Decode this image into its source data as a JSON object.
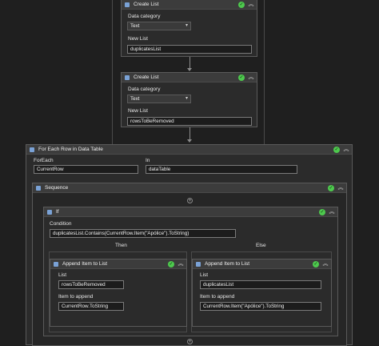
{
  "create_list_1": {
    "title": "Create List",
    "data_category_label": "Data category",
    "data_category_value": "Text",
    "new_list_label": "New List",
    "new_list_value": "duplicatesList"
  },
  "create_list_2": {
    "title": "Create List",
    "data_category_label": "Data category",
    "data_category_value": "Text",
    "new_list_label": "New List",
    "new_list_value": "rowsToBeRemoved"
  },
  "for_each": {
    "title": "For Each Row in Data Table",
    "foreach_label": "ForEach",
    "foreach_value": "CurrentRow",
    "in_label": "In",
    "in_value": "dataTable"
  },
  "sequence": {
    "title": "Sequence"
  },
  "if_block": {
    "title": "If",
    "condition_label": "Condition",
    "condition_value": "duplicatesList.Contains(CurrentRow.Item(\"Apólice\").ToString)",
    "then_label": "Then",
    "else_label": "Else"
  },
  "append_then": {
    "title": "Append Item to List",
    "list_label": "List",
    "list_value": "rowsToBeRemoved",
    "item_label": "Item to append",
    "item_value": "CurrentRow.ToString"
  },
  "append_else": {
    "title": "Append Item to List",
    "list_label": "List",
    "list_value": "duplicatesList",
    "item_label": "Item to append",
    "item_value": "CurrentRow.Item(\"Apólice\").ToString"
  },
  "icons": {
    "success": "check-circle-icon",
    "collapse": "double-chevron-up-icon",
    "add": "plus-circle-icon"
  },
  "colors": {
    "success": "#4ec94e",
    "canvas": "#1f1f1f",
    "header": "#3c3c3c"
  }
}
